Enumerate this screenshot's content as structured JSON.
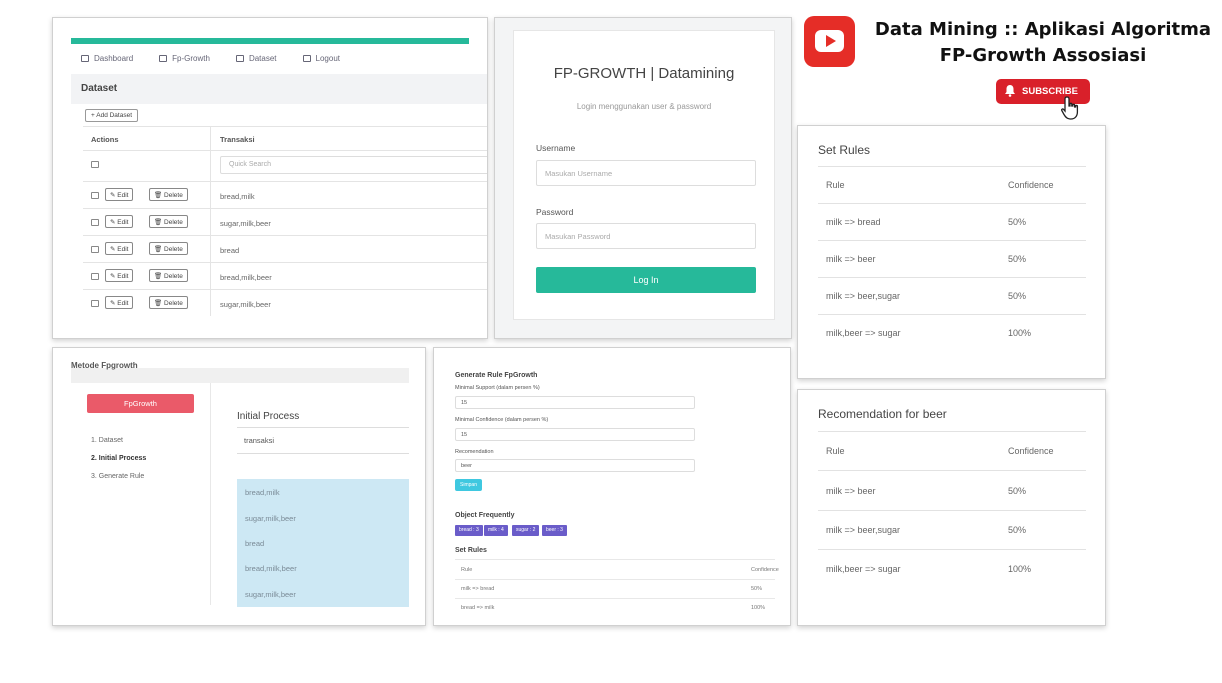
{
  "header": {
    "title_line1": "Data Mining :: Aplikasi Algoritma",
    "title_line2": "FP-Growth Assosiasi",
    "subscribe_label": "SUBSCRIBE"
  },
  "dataset_panel": {
    "nav": [
      "Dashboard",
      "Fp-Growth",
      "Dataset",
      "Logout"
    ],
    "heading": "Dataset",
    "add_button": "+ Add Dataset",
    "columns": [
      "Actions",
      "Transaksi"
    ],
    "search_placeholder": "Quick Search",
    "edit_label": "✎ Edit",
    "delete_label": "🗑 Delete",
    "rows": [
      "bread,milk",
      "sugar,milk,beer",
      "bread",
      "bread,milk,beer",
      "sugar,milk,beer"
    ]
  },
  "login_panel": {
    "title": "FP-GROWTH | Datamining",
    "subtitle": "Login menggunakan user & password",
    "username_label": "Username",
    "username_placeholder": "Masukan Username",
    "password_label": "Password",
    "password_placeholder": "Masukan Password",
    "button": "Log In"
  },
  "rules_panel": {
    "title": "Set Rules",
    "columns": [
      "Rule",
      "Confidence"
    ],
    "rows": [
      {
        "rule": "milk => bread",
        "confidence": "50%"
      },
      {
        "rule": "milk => beer",
        "confidence": "50%"
      },
      {
        "rule": "milk => beer,sugar",
        "confidence": "50%"
      },
      {
        "rule": "milk,beer => sugar",
        "confidence": "100%"
      }
    ]
  },
  "reco_panel": {
    "title": "Recomendation for beer",
    "columns": [
      "Rule",
      "Confidence"
    ],
    "rows": [
      {
        "rule": "milk => beer",
        "confidence": "50%"
      },
      {
        "rule": "milk => beer,sugar",
        "confidence": "50%"
      },
      {
        "rule": "milk,beer => sugar",
        "confidence": "100%"
      }
    ]
  },
  "process_panel": {
    "top_title": "Metode Fpgrowth",
    "button": "FpGrowth",
    "steps": [
      "1. Dataset",
      "2. Initial Process",
      "3. Generate Rule"
    ],
    "section_title": "Initial Process",
    "column": "transaksi",
    "items": [
      "bread,milk",
      "sugar,milk,beer",
      "bread",
      "bread,milk,beer",
      "sugar,milk,beer"
    ]
  },
  "generate_panel": {
    "title": "Generate Rule FpGrowth",
    "support_label": "Minimal Support (dalam persen %)",
    "support_value": "15",
    "confidence_label": "Minimal Confidence (dalam persen %)",
    "confidence_value": "15",
    "reco_label": "Recomendation",
    "reco_value": "beer",
    "button": "Simpan",
    "frequent_title": "Object Frequently",
    "badges": [
      "bread : 3",
      "milk : 4",
      "sugar : 2",
      "beer : 3"
    ],
    "rules_title": "Set Rules",
    "columns": [
      "Rule",
      "Confidence"
    ],
    "rows": [
      {
        "rule": "milk => bread",
        "confidence": "50%"
      },
      {
        "rule": "bread => milk",
        "confidence": "100%"
      }
    ]
  },
  "colors": {
    "primary_green": "#26b99a",
    "youtube_red": "#e52d27",
    "fpgrowth_button": "#ea5a69",
    "badge_purple": "#6a5cc9",
    "save_button": "#3fc8e0",
    "highlight_blue": "#cde8f4"
  }
}
